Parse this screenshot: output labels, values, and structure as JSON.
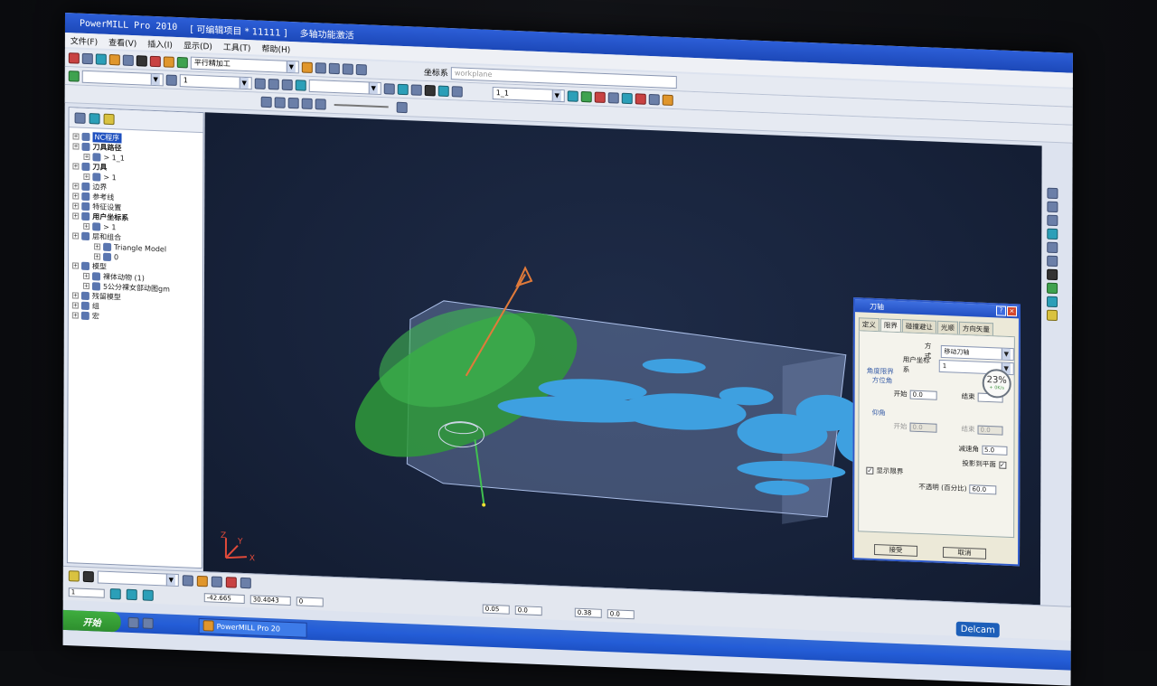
{
  "window": {
    "app_name": "PowerMILL Pro 2010",
    "project": "[ 可编辑项目 * 11111 ]",
    "subtitle": "多轴功能激活"
  },
  "menu": [
    "文件(F)",
    "查看(V)",
    "插入(I)",
    "显示(D)",
    "工具(T)",
    "帮助(H)"
  ],
  "toolbar": {
    "strategy_select": "平行精加工",
    "coord_label": "坐标系",
    "coord_value": "workplane",
    "tool_select": "1",
    "toolpath_select": "1_1"
  },
  "explorer": {
    "items": [
      {
        "label": "NC程序",
        "level": 0,
        "selected": true
      },
      {
        "label": "刀具路径",
        "level": 0,
        "bold": true
      },
      {
        "label": "> 1_1",
        "level": 1
      },
      {
        "label": "刀具",
        "level": 0,
        "bold": true
      },
      {
        "label": "> 1",
        "level": 1
      },
      {
        "label": "边界",
        "level": 0
      },
      {
        "label": "参考线",
        "level": 0
      },
      {
        "label": "特征设置",
        "level": 0
      },
      {
        "label": "用户坐标系",
        "level": 0,
        "bold": true
      },
      {
        "label": "> 1",
        "level": 1
      },
      {
        "label": "层和组合",
        "level": 0
      },
      {
        "label": "Triangle Model",
        "level": 2
      },
      {
        "label": "0",
        "level": 2
      },
      {
        "label": "模型",
        "level": 0
      },
      {
        "label": "裸体动物 (1)",
        "level": 1
      },
      {
        "label": "5公分裸女部动图gm",
        "level": 1
      },
      {
        "label": "残留模型",
        "level": 0
      },
      {
        "label": "组",
        "level": 0
      },
      {
        "label": "宏",
        "level": 0
      }
    ]
  },
  "viewport": {
    "axis_labels": [
      "Z",
      "Y",
      "X"
    ]
  },
  "dialog": {
    "title": "刀轴",
    "tabs": [
      "定义",
      "限界",
      "碰撞避让",
      "光顺",
      "方向矢量"
    ],
    "active_tab": "限界",
    "mode_label": "方式",
    "mode_value": "移动刀轴",
    "ucs_label": "用户坐标系",
    "ucs_value": "1",
    "angle_limit_label": "角度限界",
    "azimuth_label": "方位角",
    "start_label": "开始",
    "start_value": "0.0",
    "end_label": "结束",
    "elevation_label": "仰角",
    "start2_label": "开始",
    "start2_value": "0.0",
    "end2_label": "结束",
    "end2_value": "0.0",
    "chamfer_label": "减速角",
    "chamfer_value": "5.0",
    "project_label": "投影到平面",
    "show_limit_label": "显示限界",
    "opacity_label": "不透明 (百分比)",
    "opacity_value": "60.0",
    "progress_percent": "23%",
    "progress_sub": "+ 0K/s",
    "accept_label": "接受",
    "cancel_label": "取消"
  },
  "status": {
    "tool_value": "1",
    "coord_x": "-42.665",
    "coord_y": "30.4043",
    "coord_z": "0",
    "val1": "0.05",
    "val2": "0.0",
    "val3": "0.38",
    "val4": "0.0"
  },
  "taskbar": {
    "start_label": "开始",
    "task_label": "PowerMILL Pro 20",
    "brand": "Delcam"
  },
  "colors": {
    "model": "#3ea0e0",
    "limit_disc": "#2f9a3a",
    "viewport_bg": "#17223a",
    "title_blue": "#2350c2"
  }
}
